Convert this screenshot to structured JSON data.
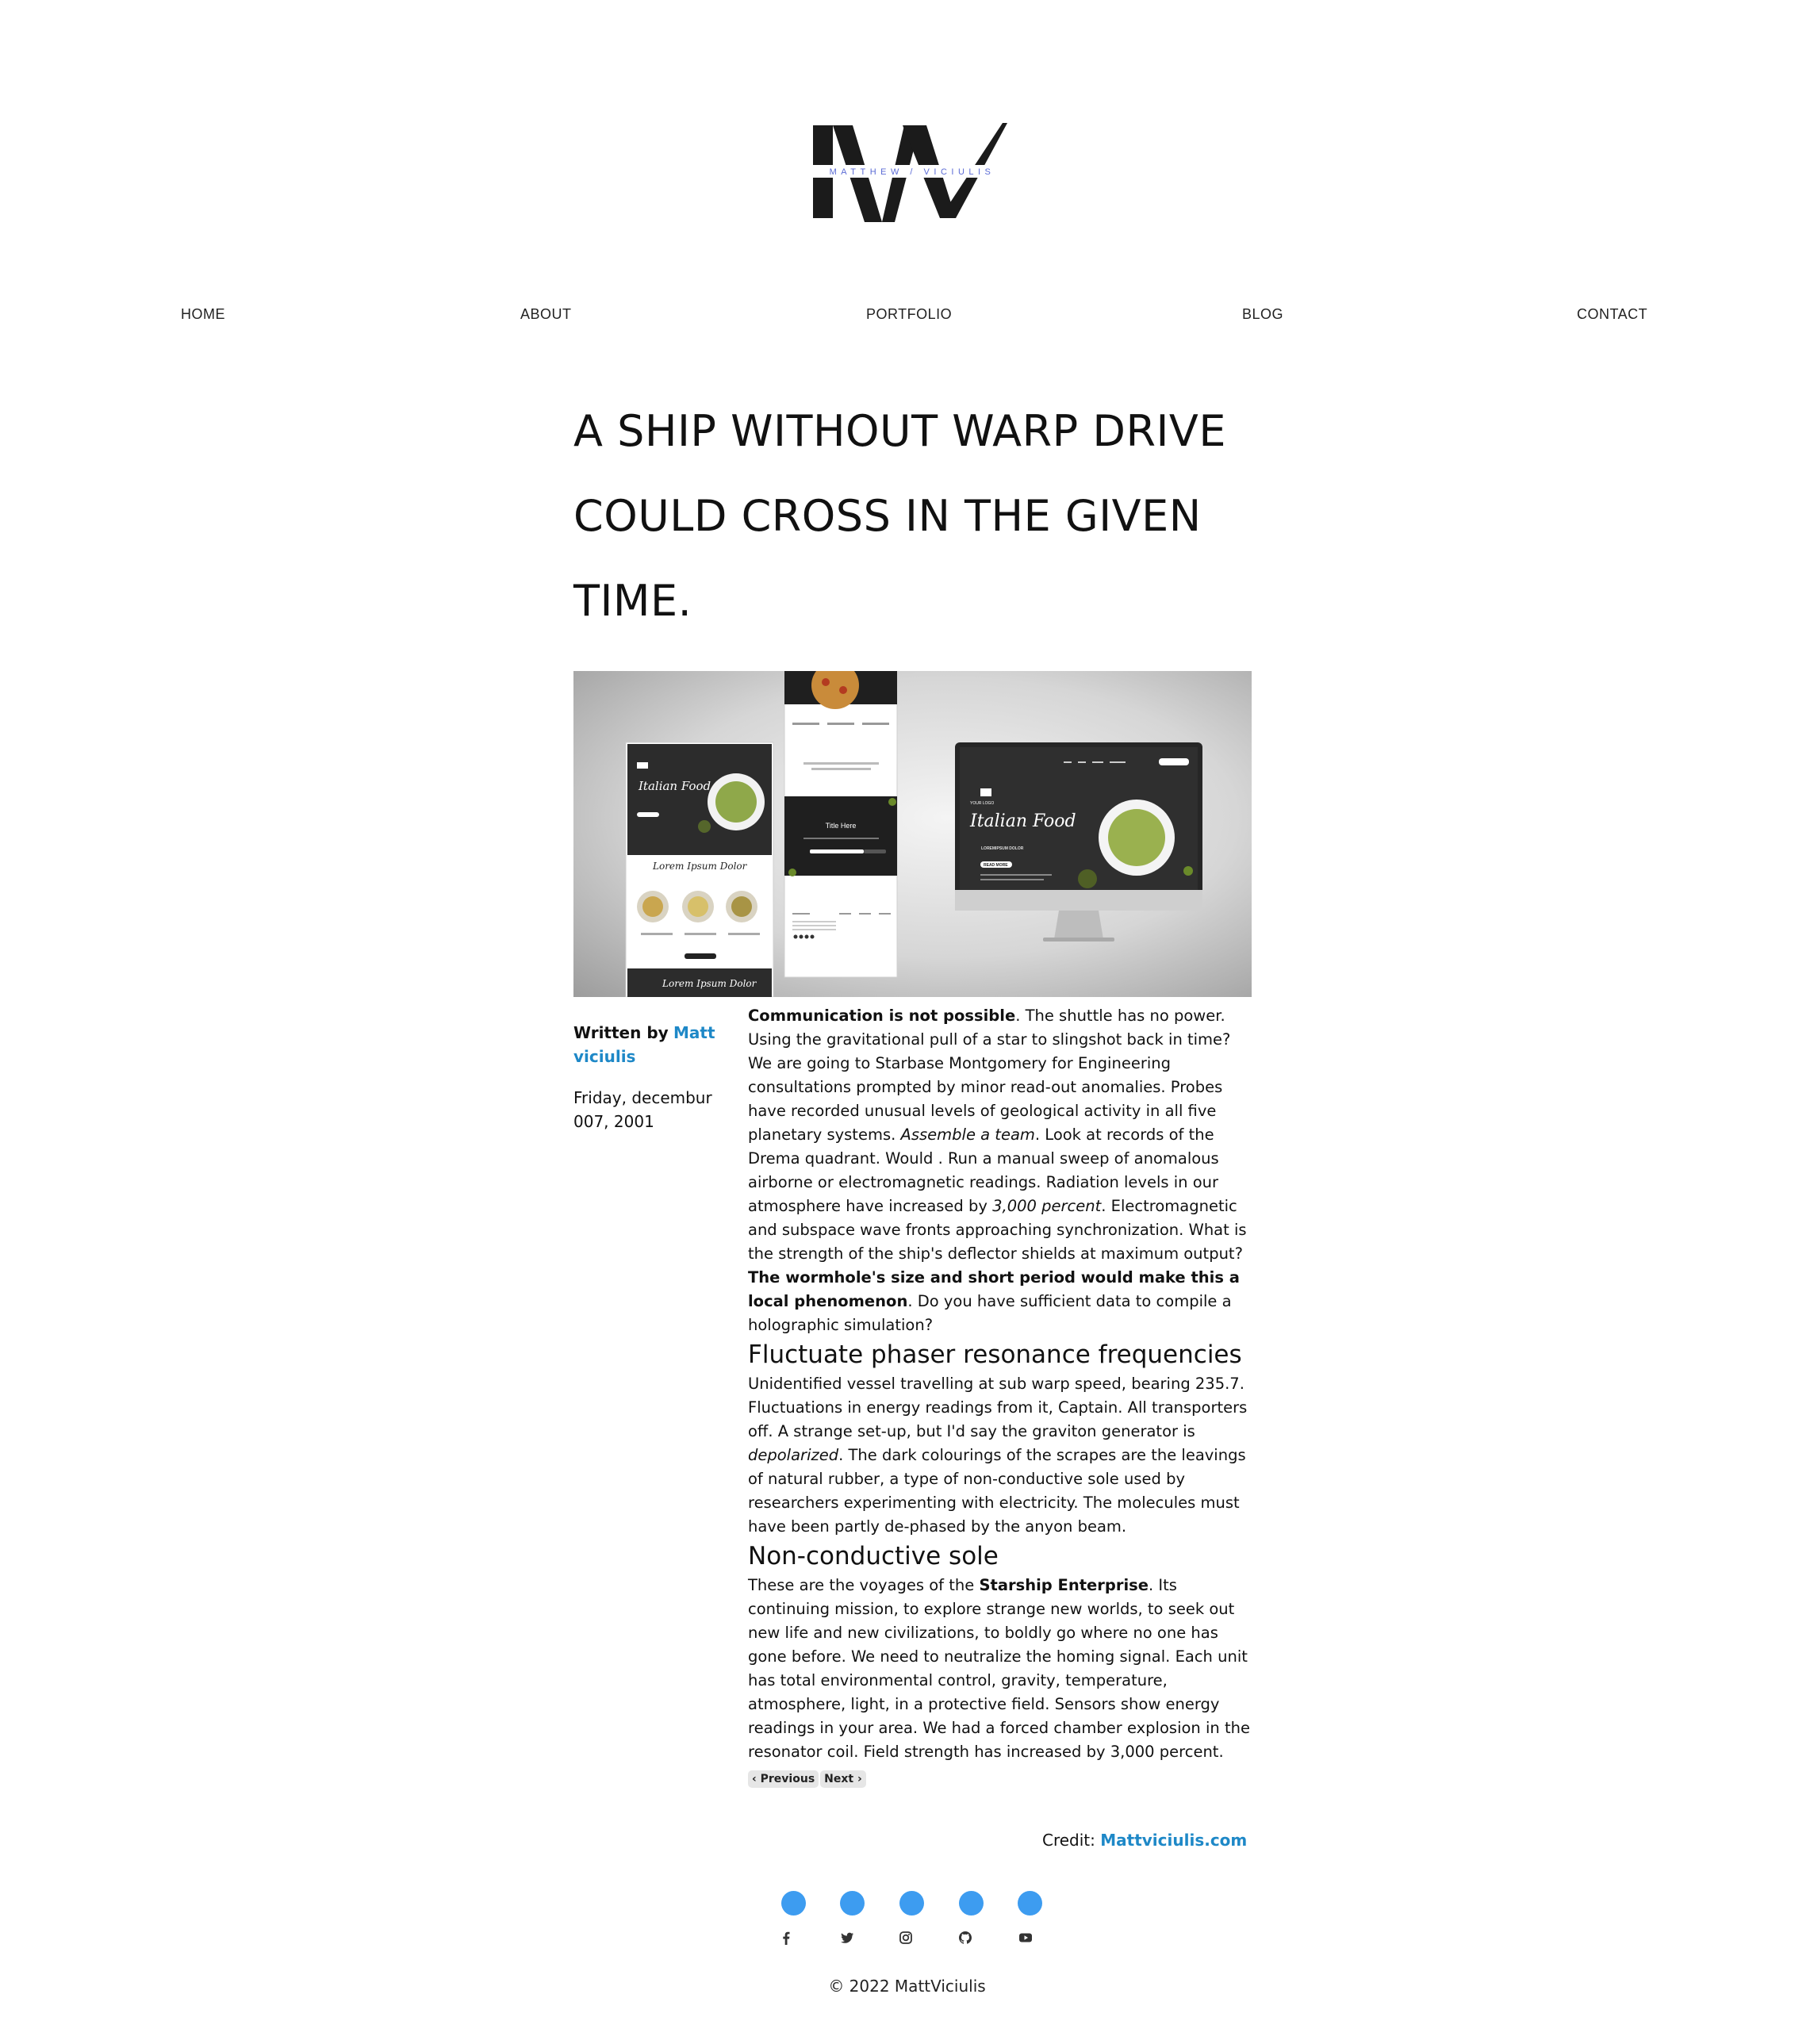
{
  "logo": {
    "initials": "MV",
    "tagline": "MATTHEW / VICIULIS"
  },
  "nav": {
    "home": "HOME",
    "about": "ABOUT",
    "portfolio": "PORTFOLIO",
    "blog": "BLOG",
    "contact": "CONTACT"
  },
  "post": {
    "title_line1": "A SHIP WITHOUT WARP DRIVE",
    "title_line2": "COULD CROSS IN THE GIVEN",
    "title_line3": "TIME.",
    "hero": {
      "brand": "Italian Food",
      "subtitle": "LOREMIPSUM DOLOR",
      "button": "READ MORE",
      "section_heading": "Lorem Ipsum Dolor",
      "tablet_heading": "Title Here",
      "logo_label": "YOUR LOGO"
    },
    "meta": {
      "written_by": "Written by",
      "author": "Matt viciulis",
      "date": "Friday, decembur 007, 2001"
    },
    "p1": {
      "b1": "Communication is not possible",
      "t1": ". The shuttle has no power. Using the gravitational pull of a star to slingshot back in time? We are going to Starbase Montgomery for Engineering consultations prompted by minor read-out anomalies. Probes have recorded unusual levels of geological activity in all five planetary systems. ",
      "i1": "Assemble a team",
      "t2": ". Look at records of the Drema quadrant. Would . Run a manual sweep of anomalous airborne or electromagnetic readings. Radiation levels in our atmosphere have increased by ",
      "i2": "3,000 percent",
      "t3": ". Electromagnetic and subspace wave fronts approaching synchronization. What is the strength of the ship's deflector shields at maximum output? ",
      "b2": "The wormhole's size and short period would make this a local phenomenon",
      "t4": ". Do you have sufficient data to compile a holographic simulation?"
    },
    "h2_1": "Fluctuate phaser resonance frequencies",
    "p2": {
      "t1": "Unidentified vessel travelling at sub warp speed, bearing 235.7. Fluctuations in energy readings from it, Captain. All transporters off. A strange set-up, but I'd say the graviton generator is ",
      "i1": "depolarized",
      "t2": ". The dark colourings of the scrapes are the leavings of natural rubber, a type of non-conductive sole used by researchers experimenting with electricity. The molecules must have been partly de-phased by the anyon beam."
    },
    "h2_2": "Non-conductive sole",
    "p3": {
      "t1": "These are the voyages of the ",
      "b1": "Starship Enterprise",
      "t2": ". Its continuing mission, to explore strange new worlds, to seek out new life and new civilizations, to boldly go where no one has gone before. We need to neutralize the homing signal. Each unit has total environmental control, gravity, temperature, atmosphere, light, in a protective field. Sensors show energy readings in your area. We had a forced chamber explosion in the resonator coil. Field strength has increased by 3,000 percent."
    },
    "pager": {
      "prev": "‹ Previous",
      "next": "Next ›"
    }
  },
  "credit": {
    "label": "Credit:",
    "link": "Mattviciulis.com"
  },
  "social": {
    "icons": [
      "facebook-icon",
      "twitter-icon",
      "instagram-icon",
      "github-icon",
      "youtube-icon"
    ],
    "dot_color": "#3d9cf0"
  },
  "footer": {
    "copyright": "© 2022 MattViciulis"
  },
  "colors": {
    "link": "#1e88c7",
    "text": "#111111"
  }
}
